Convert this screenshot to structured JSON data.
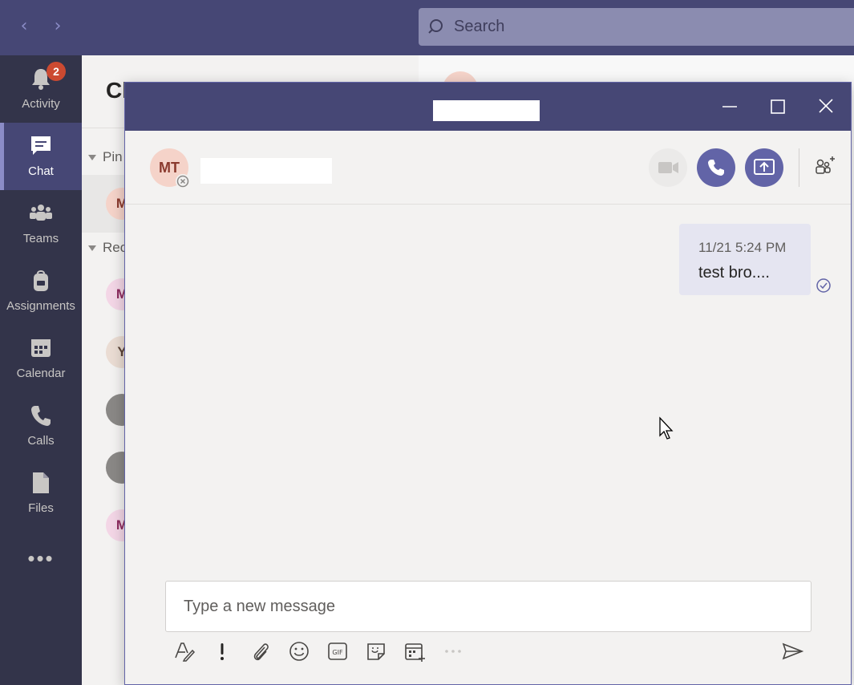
{
  "topbar": {
    "back_icon": "chevron-left-icon",
    "forward_icon": "chevron-right-icon",
    "search_placeholder": "Search"
  },
  "rail": {
    "items": [
      {
        "label": "Activity",
        "icon": "bell-icon",
        "badge": "2"
      },
      {
        "label": "Chat",
        "icon": "chat-icon",
        "active": true
      },
      {
        "label": "Teams",
        "icon": "teams-icon"
      },
      {
        "label": "Assignments",
        "icon": "backpack-icon"
      },
      {
        "label": "Calendar",
        "icon": "calendar-icon"
      },
      {
        "label": "Calls",
        "icon": "phone-icon"
      },
      {
        "label": "Files",
        "icon": "file-icon"
      }
    ],
    "more": "•••"
  },
  "chatlist": {
    "title": "Ch",
    "pinned_label": "Pin",
    "recent_label": "Rec",
    "avatars": [
      {
        "initials": "M",
        "bg": "#f5d3c9",
        "fg": "#8b3a2e"
      },
      {
        "initials": "M",
        "bg": "#f3d6e6",
        "fg": "#8e2c60"
      },
      {
        "initials": "Y",
        "bg": "#eadcd3",
        "fg": "#5c4438"
      },
      {
        "initials": "",
        "bg": "#8a8886",
        "fg": "#ffffff"
      },
      {
        "initials": "",
        "bg": "#8a8886",
        "fg": "#ffffff"
      },
      {
        "initials": "M",
        "bg": "#f3d6e6",
        "fg": "#8e2c60"
      }
    ]
  },
  "popout": {
    "minimize_icon": "minimize-icon",
    "maximize_icon": "maximize-icon",
    "close_icon": "close-icon",
    "user_initials": "MT",
    "presence_icon": "offline-icon",
    "header_buttons": [
      "video-call-icon",
      "audio-call-icon",
      "screen-share-icon",
      "add-people-icon"
    ],
    "messages": [
      {
        "time": "11/21 5:24 PM",
        "text": "test bro....",
        "status_icon": "sent-check-icon"
      }
    ],
    "composer_placeholder": "Type a new message",
    "toolbar": [
      "format-icon",
      "important-icon",
      "attach-icon",
      "emoji-icon",
      "gif-icon",
      "sticker-icon",
      "schedule-meeting-icon",
      "more-options-icon",
      "send-icon"
    ]
  },
  "colors": {
    "brand": "#464775",
    "accent": "#6264a7",
    "rail": "#33344a",
    "badge": "#cc4a31"
  }
}
